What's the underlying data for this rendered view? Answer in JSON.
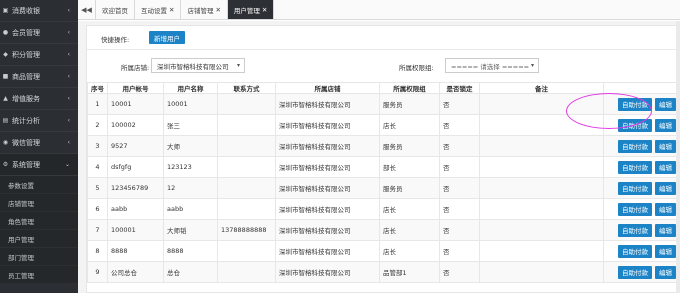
{
  "sidebar": {
    "items": [
      {
        "label": "消费收银",
        "icon": "cart-icon"
      },
      {
        "label": "会员管理",
        "icon": "user-icon"
      },
      {
        "label": "积分管理",
        "icon": "points-icon"
      },
      {
        "label": "商品管理",
        "icon": "goods-icon"
      },
      {
        "label": "增值服务",
        "icon": "service-icon"
      },
      {
        "label": "统计分析",
        "icon": "chart-icon"
      },
      {
        "label": "微信管理",
        "icon": "wechat-icon"
      },
      {
        "label": "系统管理",
        "icon": "system-icon"
      }
    ],
    "subitems": [
      "参数设置",
      "店铺管理",
      "角色管理",
      "用户管理",
      "部门管理",
      "员工管理"
    ]
  },
  "tabs": {
    "nav_label": "◀◀",
    "items": [
      {
        "label": "欢迎首页",
        "closable": false
      },
      {
        "label": "互动设置",
        "closable": true
      },
      {
        "label": "店铺管理",
        "closable": true
      },
      {
        "label": "用户管理",
        "closable": true
      }
    ],
    "close_glyph": "✕"
  },
  "quick": {
    "label": "快捷操作:",
    "add_button": "新增用户"
  },
  "filters": {
    "store_label": "所属店铺:",
    "store_value": "深圳市智榕科技有限公司",
    "role_label": "所属权限组:",
    "role_value": "===== 请选择 ====="
  },
  "table": {
    "headers": [
      "序号",
      "用户帐号",
      "用户名称",
      "联系方式",
      "所属店铺",
      "所属权限组",
      "是否锁定",
      "备注",
      ""
    ],
    "rows": [
      {
        "no": "1",
        "account": "10001",
        "name": "10001",
        "phone": "",
        "store": "深圳市智榕科技有限公司",
        "role": "服务员",
        "locked": "否",
        "note": ""
      },
      {
        "no": "2",
        "account": "100002",
        "name": "张三",
        "phone": "",
        "store": "深圳市智榕科技有限公司",
        "role": "店长",
        "locked": "否",
        "note": ""
      },
      {
        "no": "3",
        "account": "9527",
        "name": "大师",
        "phone": "",
        "store": "深圳市智榕科技有限公司",
        "role": "服务员",
        "locked": "否",
        "note": ""
      },
      {
        "no": "4",
        "account": "dsfgfg",
        "name": "123123",
        "phone": "",
        "store": "深圳市智榕科技有限公司",
        "role": "部长",
        "locked": "否",
        "note": ""
      },
      {
        "no": "5",
        "account": "123456789",
        "name": "12",
        "phone": "",
        "store": "深圳市智榕科技有限公司",
        "role": "服务员",
        "locked": "否",
        "note": ""
      },
      {
        "no": "6",
        "account": "aabb",
        "name": "aabb",
        "phone": "",
        "store": "深圳市智榕科技有限公司",
        "role": "店长",
        "locked": "否",
        "note": ""
      },
      {
        "no": "7",
        "account": "100001",
        "name": "大师韬",
        "phone": "13788888888",
        "store": "深圳市智榕科技有限公司",
        "role": "店长",
        "locked": "否",
        "note": ""
      },
      {
        "no": "8",
        "account": "8888",
        "name": "8888",
        "phone": "",
        "store": "深圳市智榕科技有限公司",
        "role": "店长",
        "locked": "否",
        "note": ""
      },
      {
        "no": "9",
        "account": "公司总仓",
        "name": "总仓",
        "phone": "",
        "store": "深圳市智榕科技有限公司",
        "role": "品管部1",
        "locked": "否",
        "note": ""
      }
    ],
    "op_pay": "自助付款",
    "op_edit": "编辑"
  },
  "colors": {
    "accent": "#1c84c6",
    "sidebar_bg": "#2b2f33",
    "annotation": "#e13be6"
  }
}
